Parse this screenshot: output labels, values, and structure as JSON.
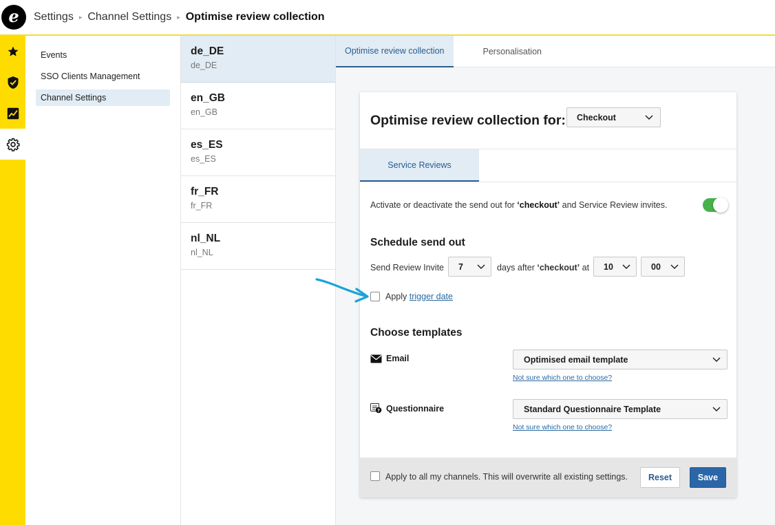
{
  "header": {
    "logo_letter": "e",
    "breadcrumb": [
      "Settings",
      "Channel Settings"
    ],
    "breadcrumb_current": "Optimise review collection",
    "separator": "▸"
  },
  "rail": {
    "icons": [
      "star-icon",
      "shield-check-icon",
      "chart-icon",
      "gear-icon"
    ],
    "accent": "#ffdc00"
  },
  "sidebar": {
    "items": [
      {
        "label": "Events"
      },
      {
        "label": "SSO Clients Management"
      },
      {
        "label": "Channel Settings"
      }
    ]
  },
  "locales": [
    {
      "code": "de_DE",
      "sub": "de_DE"
    },
    {
      "code": "en_GB",
      "sub": "en_GB"
    },
    {
      "code": "es_ES",
      "sub": "es_ES"
    },
    {
      "code": "fr_FR",
      "sub": "fr_FR"
    },
    {
      "code": "nl_NL",
      "sub": "nl_NL"
    }
  ],
  "tabs": [
    {
      "label": "Optimise review collection"
    },
    {
      "label": "Personalisation"
    }
  ],
  "card": {
    "title": "Optimise review collection for:",
    "trigger_select": "Checkout",
    "subtab": "Service Reviews",
    "activate_pre": "Activate or deactivate the send out for ",
    "activate_bold": "‘checkout’",
    "activate_post": " and Service Review invites.",
    "schedule": {
      "title": "Schedule send out",
      "send_label": "Send Review Invite",
      "days_value": "7",
      "days_after_pre": "days after ",
      "days_after_bold": "‘checkout’",
      "days_after_post": " at",
      "hour_value": "10",
      "minute_value": "00",
      "apply_pre": "Apply ",
      "apply_link": "trigger date"
    },
    "templates": {
      "title": "Choose templates",
      "email_label": "Email",
      "email_value": "Optimised email template",
      "email_help": "Not sure which one to choose?",
      "questionnaire_label": "Questionnaire",
      "questionnaire_value": "Standard Questionnaire Template",
      "questionnaire_help": "Not sure which one to choose?"
    },
    "footer": {
      "apply_all": "Apply to all my channels. This will overwrite all existing settings.",
      "reset": "Reset",
      "save": "Save"
    }
  },
  "colors": {
    "accent_yellow": "#ffdc00",
    "primary_blue": "#2b67a8",
    "toggle_green": "#48b24a",
    "annotation_arrow": "#1aa3d9"
  }
}
